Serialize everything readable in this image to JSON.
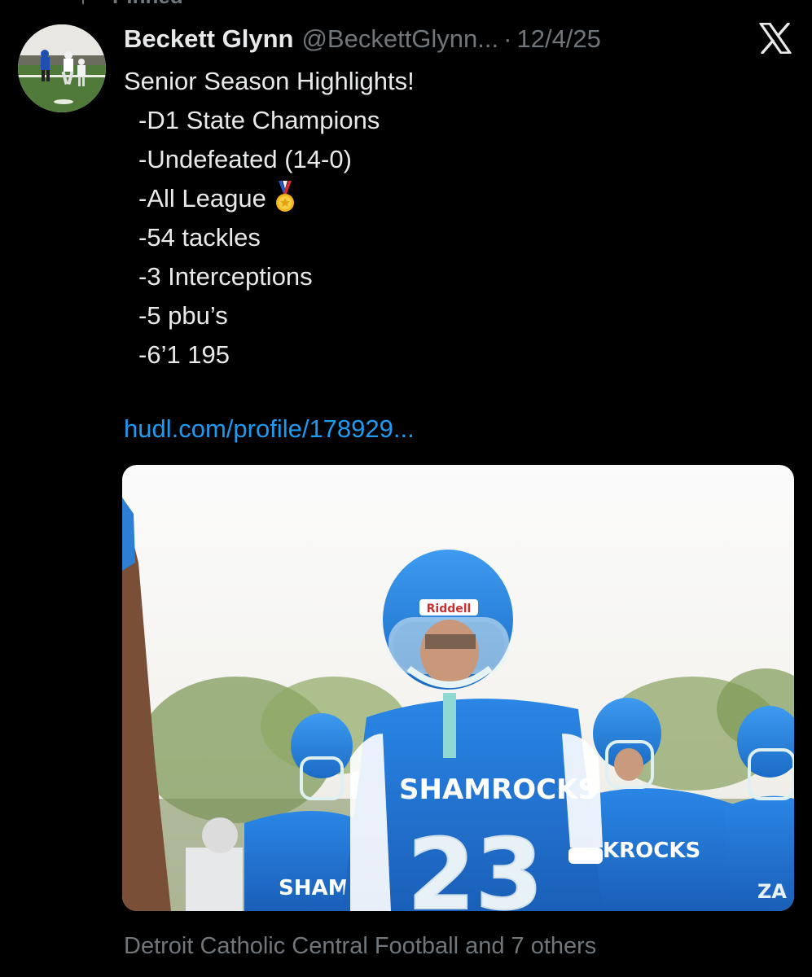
{
  "pinned": {
    "label": "Pinned",
    "icon": "pin-icon"
  },
  "tweet": {
    "author": {
      "name": "Beckett Glynn",
      "handle": "@BeckettGlynn...",
      "avatar_icon": "avatar-photo"
    },
    "separator": "·",
    "date": "12/4/25",
    "text_lines": [
      "Senior Season Highlights!",
      "-D1 State Champions",
      "-Undefeated (14-0)",
      "-All League",
      "-54 tackles",
      "-3 Interceptions",
      "-5 pbu’s",
      "-6’1 195"
    ],
    "medal_icon": "medal-icon",
    "link": "hudl.com/profile/178929...",
    "media": {
      "description_icon": "football-photo",
      "jersey_text": "SHAMROCKS",
      "jersey_number": "23",
      "helmet_brand": "Riddell",
      "watermark": "ZA"
    },
    "tagged": "Detroit Catholic Central Football and 7 others"
  },
  "app": {
    "logo_icon": "x-logo-icon"
  },
  "colors": {
    "background": "#000000",
    "text": "#e7e9ea",
    "muted": "#71767b",
    "link": "#1d9bf0",
    "jersey_blue": "#1f6fd1"
  }
}
